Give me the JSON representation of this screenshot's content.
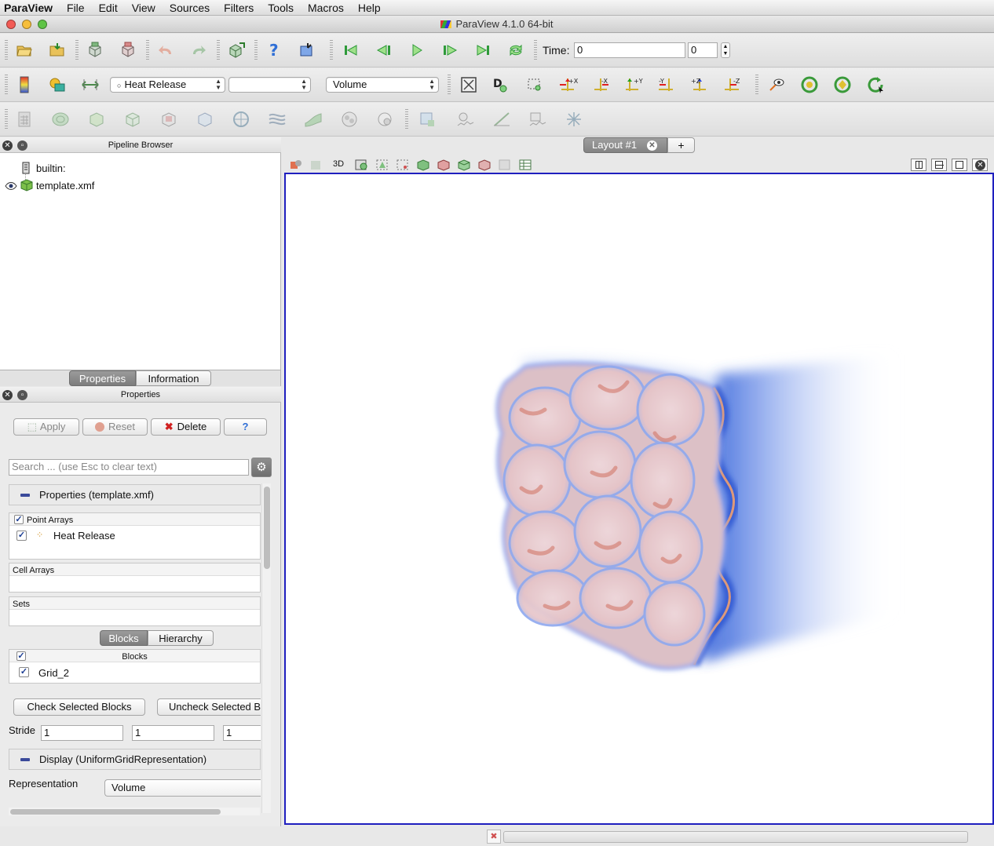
{
  "menubar": {
    "app": "ParaView",
    "items": [
      "File",
      "Edit",
      "View",
      "Sources",
      "Filters",
      "Tools",
      "Macros",
      "Help"
    ]
  },
  "window": {
    "title": "ParaView 4.1.0 64-bit"
  },
  "time_toolbar": {
    "label": "Time:",
    "value": "0",
    "step_value": "0"
  },
  "color_toolbar": {
    "array_selected": "Heat Release",
    "component_selected": "",
    "representation_selected": "Volume"
  },
  "pipeline": {
    "title": "Pipeline Browser",
    "items": [
      {
        "label": "builtin:"
      },
      {
        "label": "template.xmf"
      }
    ]
  },
  "properties_tabs": {
    "properties": "Properties",
    "information": "Information"
  },
  "properties": {
    "title": "Properties",
    "apply": "Apply",
    "reset": "Reset",
    "delete": "Delete",
    "help": "?",
    "search_placeholder": "Search ... (use Esc to clear text)",
    "section_properties": "Properties (template.xmf)",
    "point_arrays_header": "Point Arrays",
    "point_arrays": [
      "Heat Release"
    ],
    "cell_arrays_header": "Cell Arrays",
    "sets_header": "Sets",
    "blocks_tab": "Blocks",
    "hierarchy_tab": "Hierarchy",
    "blocks_header": "Blocks",
    "blocks": [
      "Grid_2"
    ],
    "check_selected": "Check Selected Blocks",
    "uncheck_selected": "Uncheck Selected Blocks",
    "stride_label": "Stride",
    "stride_values": [
      "1",
      "1",
      "1"
    ],
    "section_display": "Display (UniformGridRepresentation)",
    "representation_label": "Representation",
    "representation_value": "Volume"
  },
  "layout": {
    "tab": "Layout #1",
    "add": "+",
    "mode_3d": "3D"
  },
  "colors": {
    "selection_border": "#1f1fbf",
    "accent_blue": "#2c5bd6",
    "heat_red": "#d07060"
  }
}
